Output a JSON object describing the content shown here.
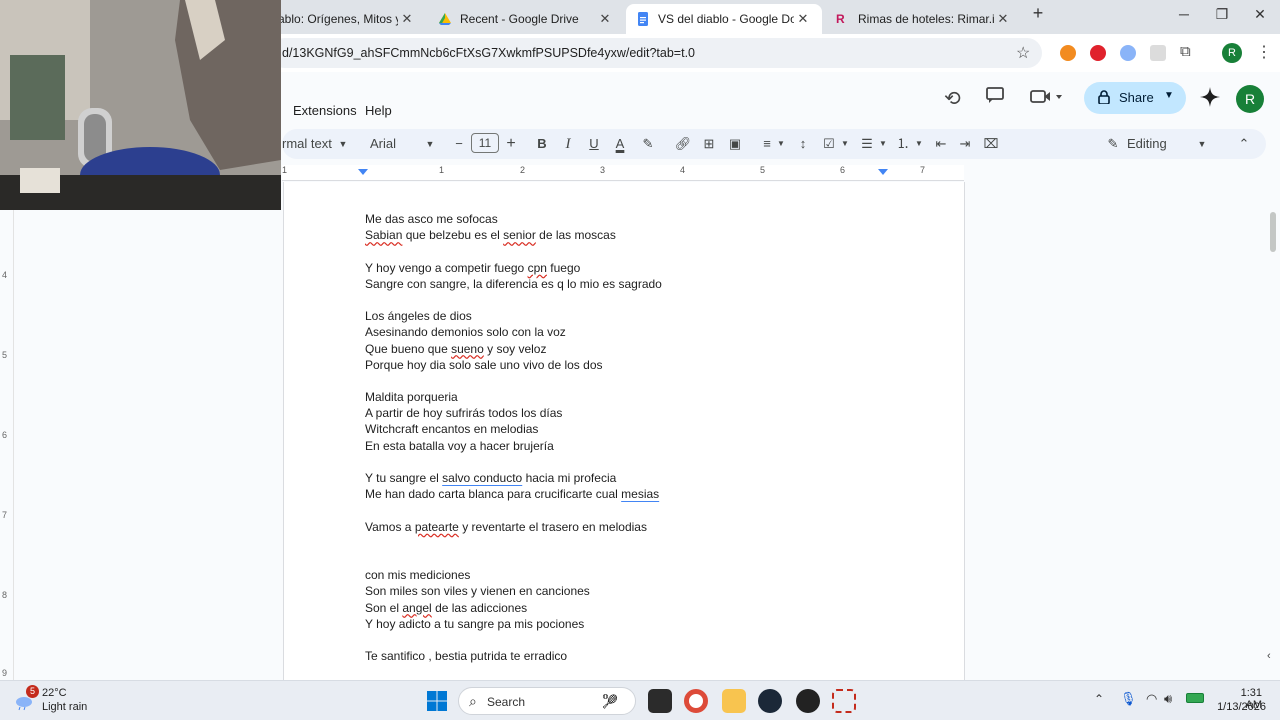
{
  "tabs": [
    {
      "title": "ablo: Orígenes, Mitos y Cu",
      "favicon": "article-icon"
    },
    {
      "title": "Recent - Google Drive",
      "favicon": "drive-icon"
    },
    {
      "title": "VS del diablo - Google Docs",
      "favicon": "docs-icon"
    },
    {
      "title": "Rimas de hoteles: Rimar.io",
      "favicon": "rimar-icon"
    }
  ],
  "address": {
    "url": "d/13KGNfG9_ahSFCmmNcb6cFtXsG7XwkmfPSUPSDfe4yxw/edit?tab=t.0"
  },
  "profile_initial": "R",
  "menu": {
    "extensions": "Extensions",
    "help": "Help"
  },
  "header": {
    "share_label": "Share",
    "avatar_initial": "R"
  },
  "toolbar": {
    "style": "rmal text",
    "font": "Arial",
    "font_size": "11",
    "mode": "Editing"
  },
  "ruler_numbers": [
    "1",
    "1",
    "2",
    "3",
    "4",
    "5",
    "6",
    "7"
  ],
  "vruler_numbers": [
    "4",
    "5",
    "6",
    "7",
    "8",
    "9"
  ],
  "document": {
    "lines": [
      [
        {
          "t": "Me das asco me sofocas"
        }
      ],
      [
        {
          "t": "Sabian",
          "s": "sq"
        },
        {
          "t": " que belzebu es el "
        },
        {
          "t": "senior",
          "s": "sq"
        },
        {
          "t": " de las moscas"
        }
      ],
      [],
      [
        {
          "t": "Y hoy vengo a competir fuego "
        },
        {
          "t": "cpn",
          "s": "sq"
        },
        {
          "t": " fuego"
        }
      ],
      [
        {
          "t": "Sangre con sangre, la diferencia es q lo mio es sagrado"
        }
      ],
      [],
      [
        {
          "t": "Los ángeles de dios"
        }
      ],
      [
        {
          "t": "Asesinando demonios solo con la voz"
        }
      ],
      [
        {
          "t": "Que bueno que "
        },
        {
          "t": "sueno",
          "s": "sq"
        },
        {
          "t": " y soy veloz"
        }
      ],
      [
        {
          "t": "Porque hoy dia solo sale uno vivo de los dos"
        }
      ],
      [],
      [
        {
          "t": "Maldita porqueria"
        }
      ],
      [
        {
          "t": "A partir de hoy sufrirás todos los días"
        }
      ],
      [
        {
          "t": "Witchcraft encantos en melodias"
        }
      ],
      [
        {
          "t": "En esta batalla voy a hacer brujería"
        }
      ],
      [],
      [
        {
          "t": "Y tu sangre el "
        },
        {
          "t": "salvo conducto",
          "s": "sq-blue"
        },
        {
          "t": " hacia mi profecia"
        }
      ],
      [
        {
          "t": "Me han dado carta blanca para crucificarte cual "
        },
        {
          "t": "mesias",
          "s": "sq-blue"
        }
      ],
      [],
      [
        {
          "t": "Vamos a "
        },
        {
          "t": "patearte",
          "s": "sq"
        },
        {
          "t": " y reventarte el trasero en melodias"
        }
      ],
      [],
      [],
      [
        {
          "t": "con mis mediciones"
        }
      ],
      [
        {
          "t": "Son miles son viles y vienen en canciones"
        }
      ],
      [
        {
          "t": "Son el "
        },
        {
          "t": "angel",
          "s": "sq"
        },
        {
          "t": " de las adicciones"
        }
      ],
      [
        {
          "t": "Y hoy adicto a tu sangre pa mis pociones"
        }
      ],
      [],
      [
        {
          "t": "Te santifico , bestia putrida te erradico"
        }
      ]
    ]
  },
  "taskbar": {
    "weather_temp": "22°C",
    "weather_desc": "Light rain",
    "weather_badge": "5",
    "search_label": "Search",
    "time": "1:31 AM",
    "date": "1/13/2026"
  },
  "colors": {
    "docs_blue": "#4285f4",
    "share_bg": "#c2e7ff",
    "avatar_green": "#188038",
    "opera_red": "#e0222c"
  }
}
